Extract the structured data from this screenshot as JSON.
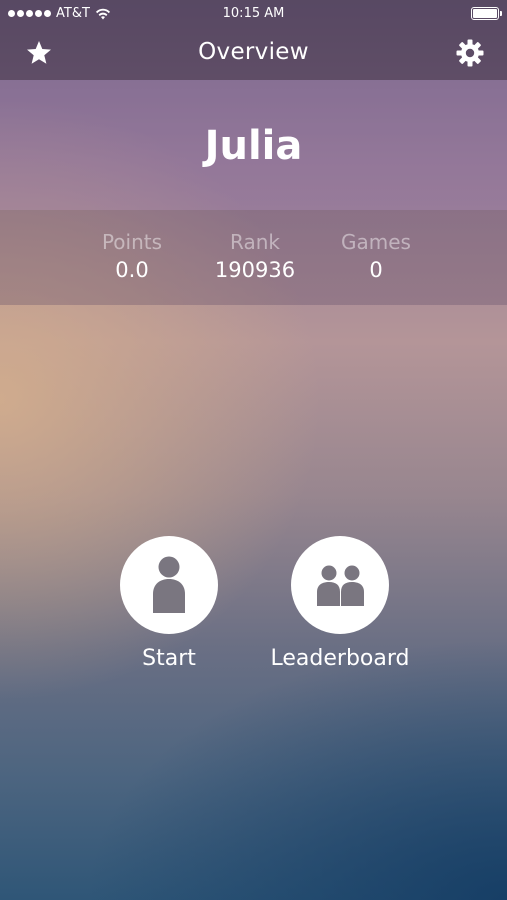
{
  "status_bar": {
    "carrier": "AT&T",
    "time": "10:15 AM",
    "signal_bars": 5
  },
  "nav": {
    "title": "Overview",
    "left_icon": "star-icon",
    "right_icon": "gear-icon"
  },
  "profile": {
    "name": "Julia"
  },
  "stats": {
    "points_label": "Points",
    "points_value": "0.0",
    "rank_label": "Rank",
    "rank_value": "190936",
    "games_label": "Games",
    "games_value": "0"
  },
  "actions": {
    "start_label": "Start",
    "start_icon": "person-icon",
    "leaderboard_label": "Leaderboard",
    "leaderboard_icon": "group-icon"
  },
  "colors": {
    "icon_gray": "#7a7680",
    "circle_fill": "#ffffff"
  }
}
